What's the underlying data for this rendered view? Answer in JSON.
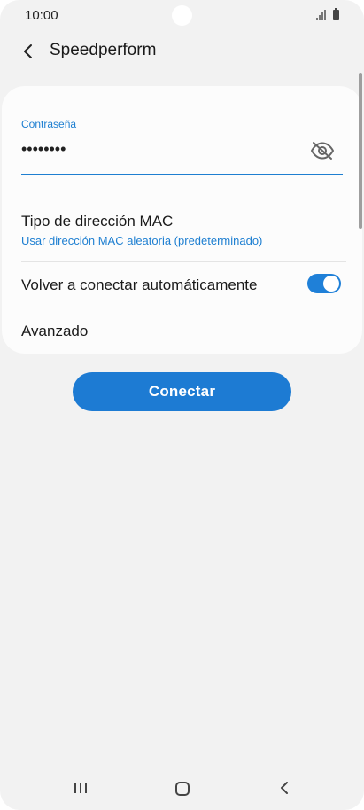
{
  "status_bar": {
    "time": "10:00",
    "icons": [
      "signal-icon",
      "battery-icon"
    ]
  },
  "header": {
    "title": "Speedperform",
    "back_icon": "chevron-left-icon"
  },
  "password": {
    "label": "Contraseña",
    "value": "••••••••",
    "visibility_icon": "eye-off-icon"
  },
  "settings": {
    "mac_type_title": "Tipo de dirección MAC",
    "mac_type_value": "Usar dirección MAC aleatoria (predeterminado)",
    "auto_reconnect_label": "Volver a conectar automáticamente",
    "auto_reconnect_on": true,
    "advanced_label": "Avanzado"
  },
  "actions": {
    "connect_label": "Conectar"
  },
  "nav_bar": {
    "icons": [
      "recents-icon",
      "home-icon",
      "back-icon"
    ]
  },
  "colors": {
    "accent": "#1e7fd1",
    "button": "#1d7bd3",
    "background": "#f2f2f2",
    "card": "#fcfcfc"
  }
}
